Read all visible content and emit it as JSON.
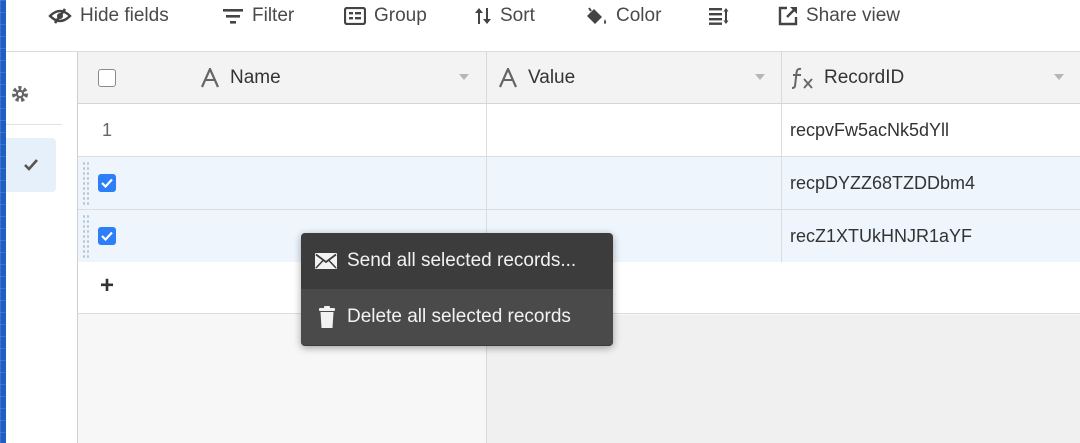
{
  "toolbar": {
    "hide_fields": "Hide fields",
    "filter": "Filter",
    "group": "Group",
    "sort": "Sort",
    "color": "Color",
    "share_view": "Share view"
  },
  "columns": [
    {
      "label": "Name",
      "type_icon": "text-type-icon"
    },
    {
      "label": "Value",
      "type_icon": "text-type-icon"
    },
    {
      "label": "RecordID",
      "type_icon": "formula-type-icon"
    }
  ],
  "rows": [
    {
      "row_label": "1",
      "selected": false,
      "record_id": "recpvFw5acNk5dYll"
    },
    {
      "row_label": "",
      "selected": true,
      "record_id": "recpDYZZ68TZDDbm4"
    },
    {
      "row_label": "",
      "selected": true,
      "record_id": "recZ1XTUkHNJR1aYF"
    }
  ],
  "context_menu": {
    "send": "Send all selected records...",
    "delete": "Delete all selected records"
  },
  "colors": {
    "accent": "#2d7ff9",
    "menu_bg": "#3c3c3c",
    "selected_row": "#eef5fd"
  }
}
